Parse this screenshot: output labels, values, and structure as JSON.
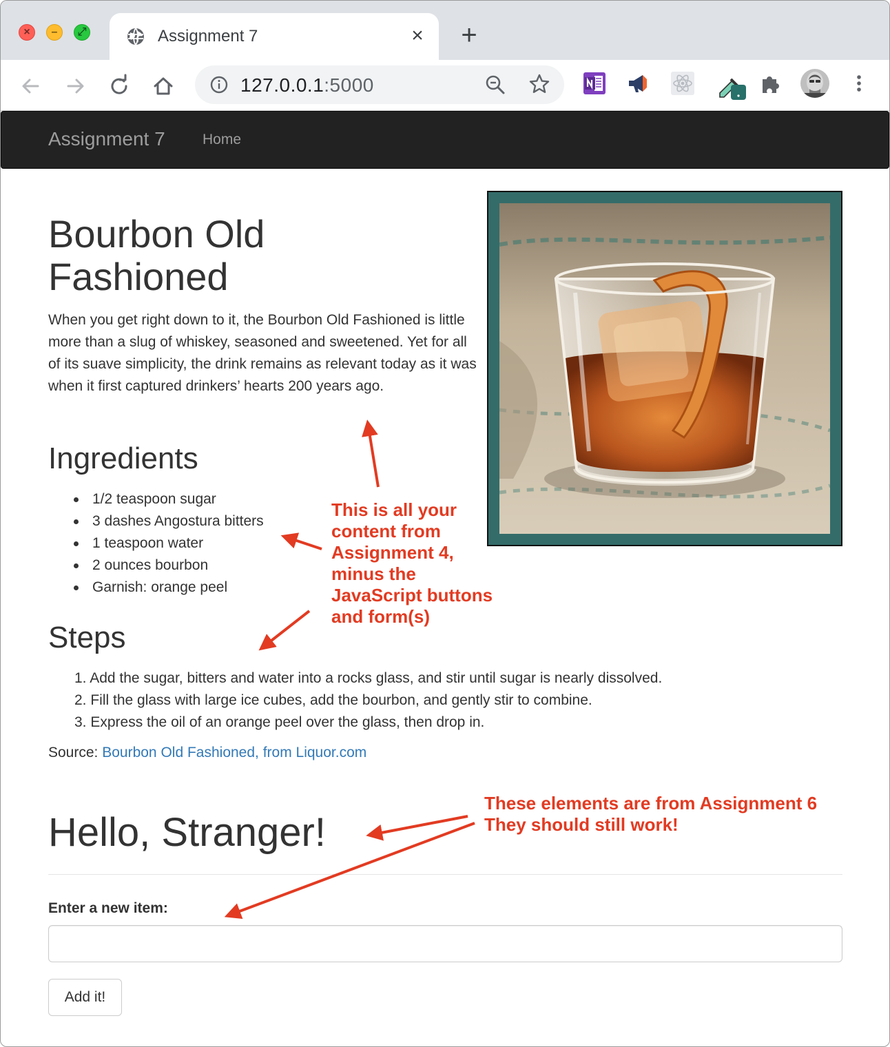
{
  "browser": {
    "tab_title": "Assignment 7",
    "tab_close_glyph": "×",
    "new_tab_glyph": "+",
    "url_host": "127.0.0.1",
    "url_port": ":5000",
    "icons": [
      "back-icon",
      "forward-icon",
      "reload-icon",
      "home-icon",
      "site-info-icon",
      "zoom-out-icon",
      "bookmark-star-icon",
      "onenote-extension-icon",
      "megaphone-extension-icon",
      "react-devtools-icon",
      "eyedropper-extension-icon",
      "extensions-puzzle-icon",
      "profile-avatar",
      "more-menu-icon"
    ]
  },
  "navbar": {
    "brand": "Assignment 7",
    "links": [
      "Home"
    ]
  },
  "recipe": {
    "title": "Bourbon Old Fashioned",
    "intro": "When you get right down to it, the Bourbon Old Fashioned is little more than a slug of whiskey, seasoned and sweetened. Yet for all of its suave simplicity, the drink remains as relevant today as it was when it first captured drinkers’ hearts 200 years ago.",
    "ingredients_heading": "Ingredients",
    "ingredients": [
      "1/2 teaspoon sugar",
      "3 dashes Angostura bitters",
      "1 teaspoon water",
      "2 ounces bourbon",
      "Garnish: orange peel"
    ],
    "steps_heading": "Steps",
    "steps": [
      "1. Add the sugar, bitters and water into a rocks glass, and stir until sugar is nearly dissolved.",
      "2. Fill the glass with large ice cubes, add the bourbon, and gently stir to combine.",
      "3. Express the oil of an orange peel over the glass, then drop in."
    ],
    "source_label": "Source: ",
    "source_link": "Bourbon Old Fashioned, from Liquor.com",
    "frame_color": "#346c6a"
  },
  "greeting": {
    "title": "Hello, Stranger!",
    "field_label": "Enter a new item:",
    "input_value": "",
    "button_label": "Add it!"
  },
  "annotations": {
    "note1": "This is all your content from Assignment 4, minus the JavaScript buttons and form(s)",
    "note2_line1": "These elements are from Assignment 6",
    "note2_line2": "They should still work!",
    "color": "#e23b22"
  }
}
